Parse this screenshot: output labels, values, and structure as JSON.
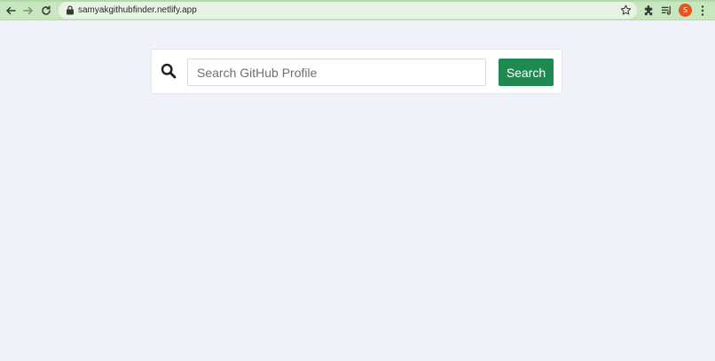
{
  "browser": {
    "url": "samyakgithubfinder.netlify.app",
    "profile_initial": "S",
    "icons": {
      "back": "back-arrow-icon",
      "forward": "forward-arrow-icon",
      "reload": "reload-icon",
      "lock": "lock-icon",
      "bookmark": "star-icon",
      "extensions": "puzzle-icon",
      "reading_list": "reading-list-icon",
      "menu": "kebab-menu-icon"
    }
  },
  "search": {
    "placeholder": "Search GitHub Profile",
    "value": "",
    "button_label": "Search",
    "icon": "search-icon"
  },
  "colors": {
    "page_background": "#f0f2fa",
    "browser_frame": "#c8e6c0",
    "button_primary": "#1e8a52",
    "avatar": "#e8541e"
  }
}
